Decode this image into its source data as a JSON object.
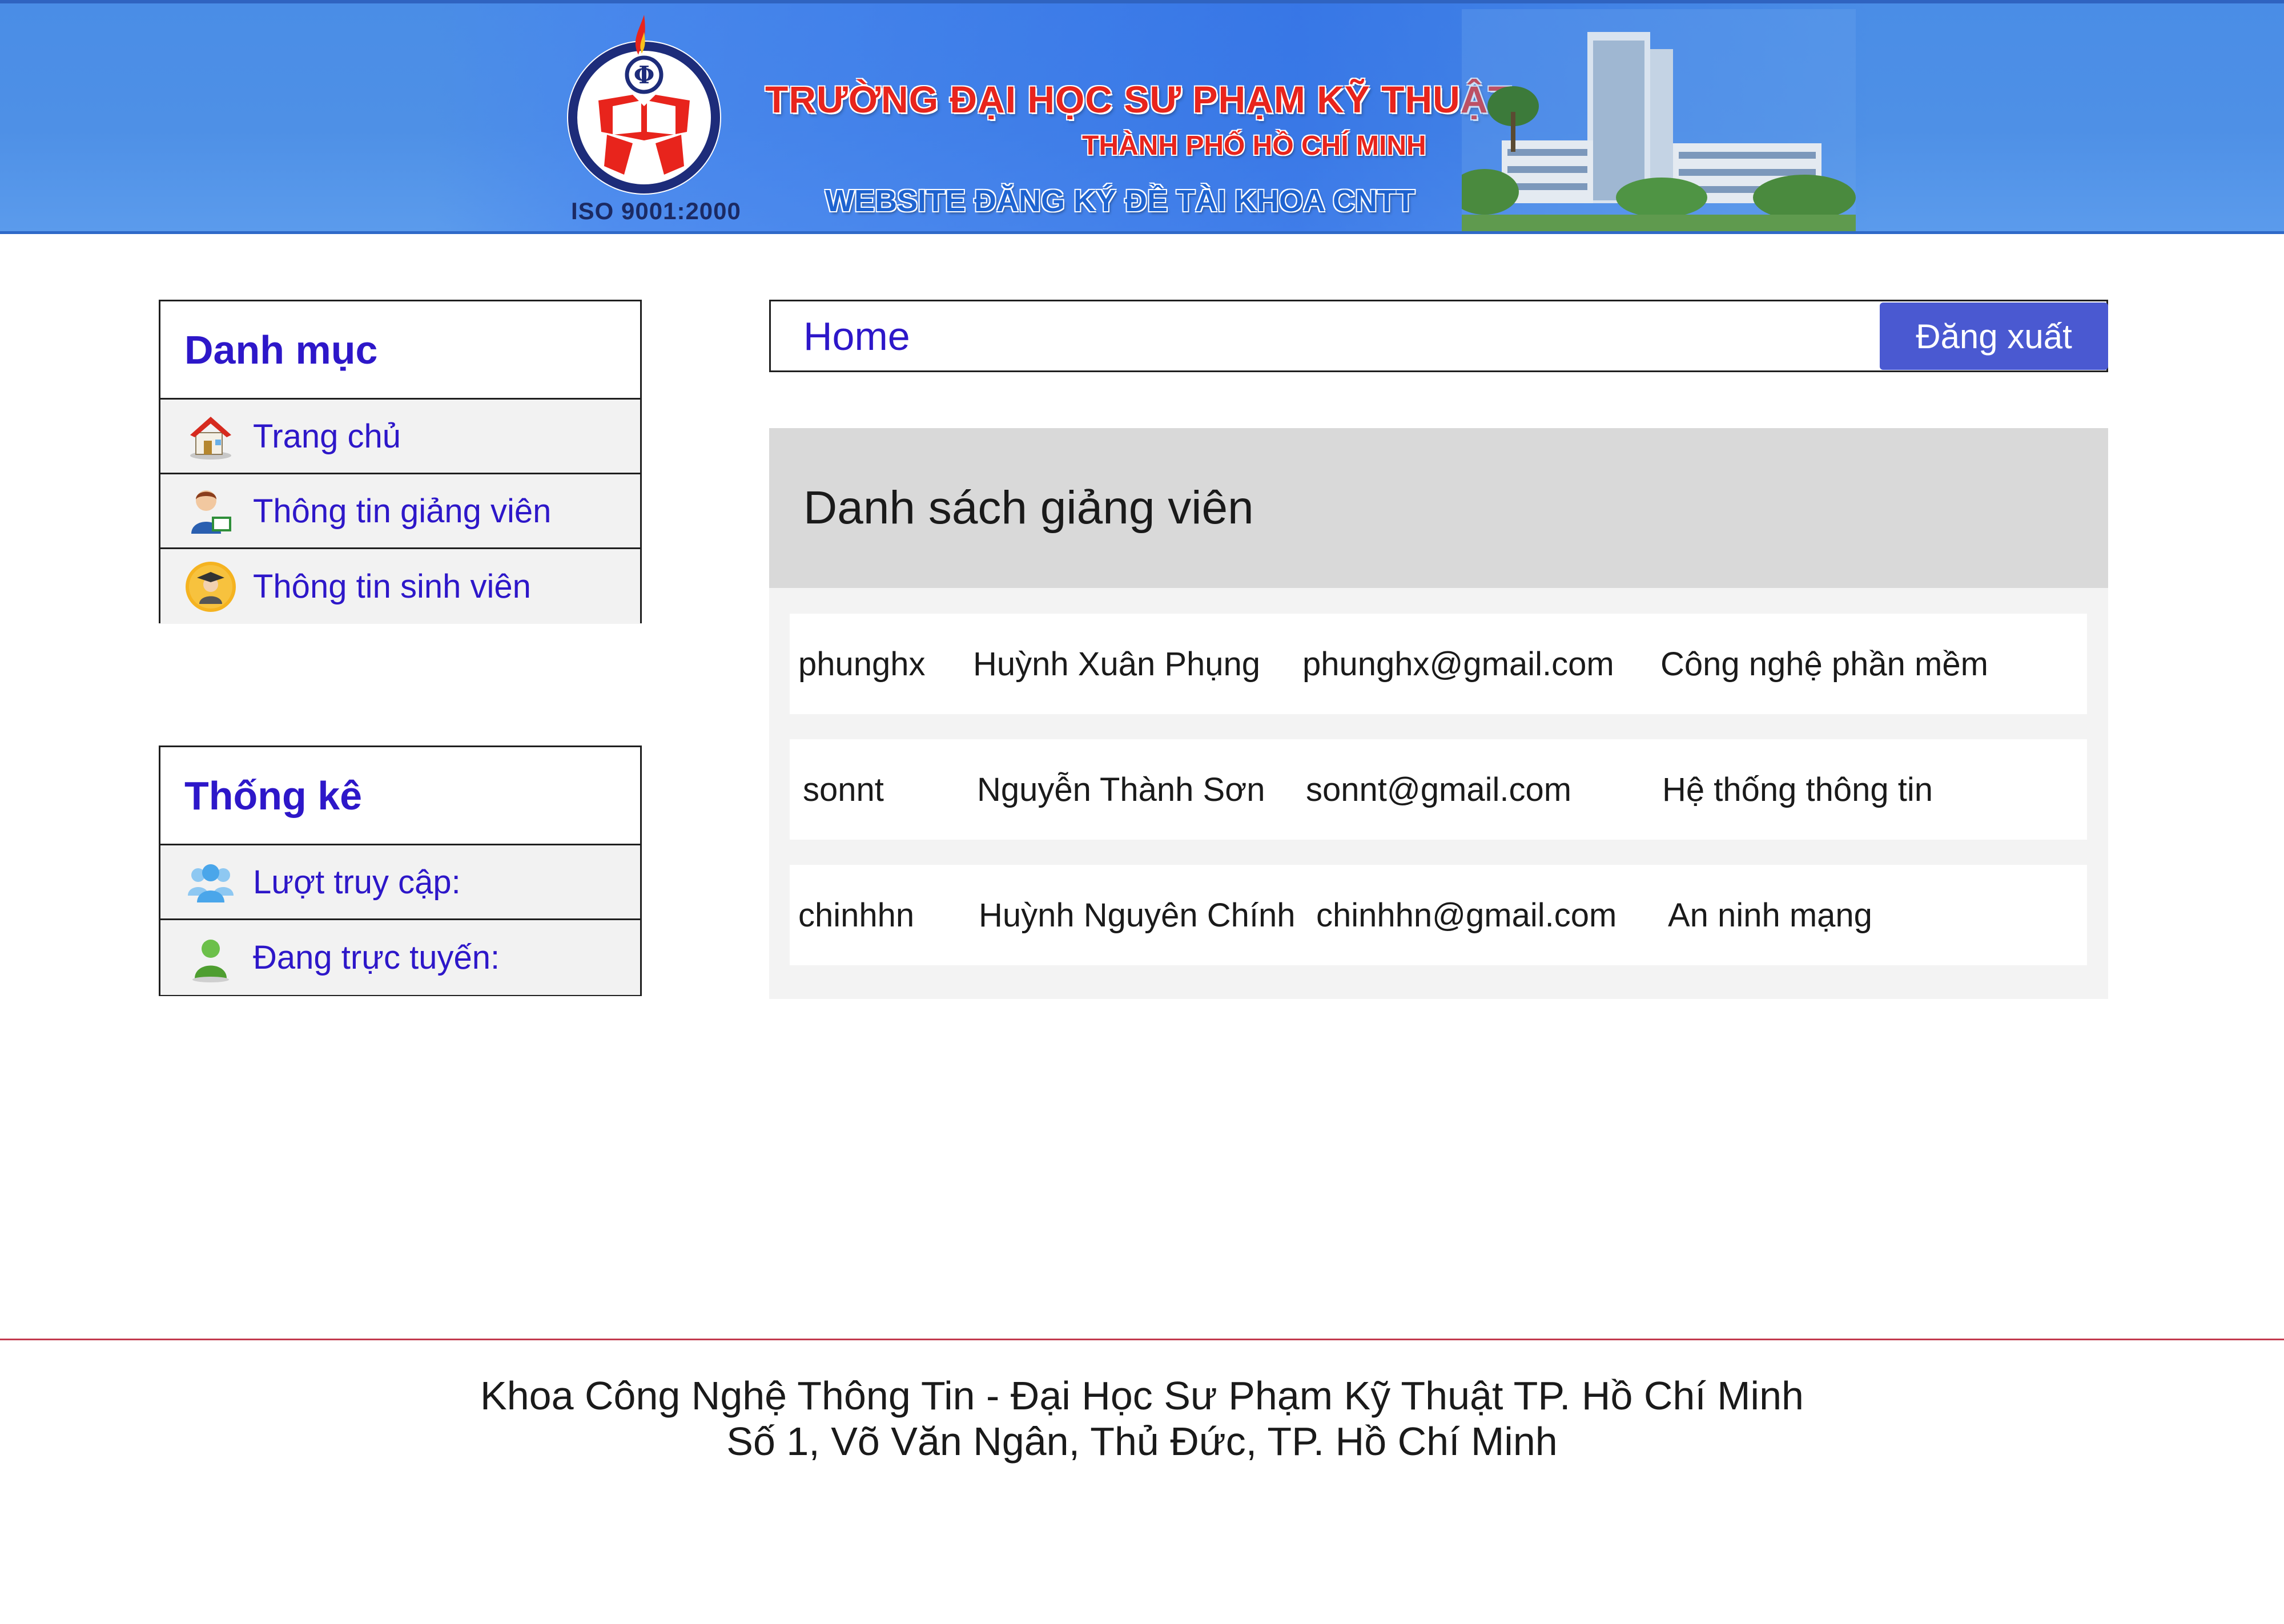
{
  "banner": {
    "title_line1": "TRƯỜNG ĐẠI HỌC SƯ PHẠM KỸ THUẬT",
    "title_line2": "THÀNH PHỐ HỒ CHÍ MINH",
    "title_line3": "WEBSITE ĐĂNG KÝ ĐỀ TÀI KHOA CNTT",
    "iso": "ISO 9001:2000"
  },
  "sidebar": {
    "menu": {
      "title": "Danh mục",
      "items": [
        {
          "label": "Trang chủ",
          "icon": "house-icon"
        },
        {
          "label": "Thông tin giảng viên",
          "icon": "teacher-icon"
        },
        {
          "label": "Thông tin sinh viên",
          "icon": "graduate-icon"
        }
      ]
    },
    "stats": {
      "title": "Thống kê",
      "items": [
        {
          "label": "Lượt truy cập:",
          "icon": "users-group-icon"
        },
        {
          "label": "Đang trực tuyến:",
          "icon": "user-online-icon"
        }
      ]
    }
  },
  "topbar": {
    "breadcrumb": "Home",
    "logout_label": "Đăng xuất"
  },
  "lecturers": {
    "title": "Danh sách giảng viên",
    "rows": [
      {
        "username": "phunghx",
        "name": "Huỳnh Xuân Phụng",
        "email": "phunghx@gmail.com",
        "department": "Công nghệ phần mềm"
      },
      {
        "username": "sonnt",
        "name": "Nguyễn Thành Sơn",
        "email": "sonnt@gmail.com",
        "department": "Hệ thống thông tin"
      },
      {
        "username": "chinhhn",
        "name": "Huỳnh Nguyên Chính",
        "email": "chinhhn@gmail.com",
        "department": "An ninh mạng"
      }
    ]
  },
  "footer": {
    "line1": "Khoa Công Nghệ Thông Tin - Đại Học Sư Phạm Kỹ Thuật TP. Hồ Chí Minh",
    "line2": "Số 1, Võ Văn Ngân, Thủ Đức, TP. Hồ Chí Minh"
  },
  "colors": {
    "banner_blue": "#4e90e6",
    "link_text": "#2d17c9",
    "logout_button": "#4a59d1",
    "list_header_bg": "#d9d9d9",
    "footer_rule": "#c23a4e"
  }
}
